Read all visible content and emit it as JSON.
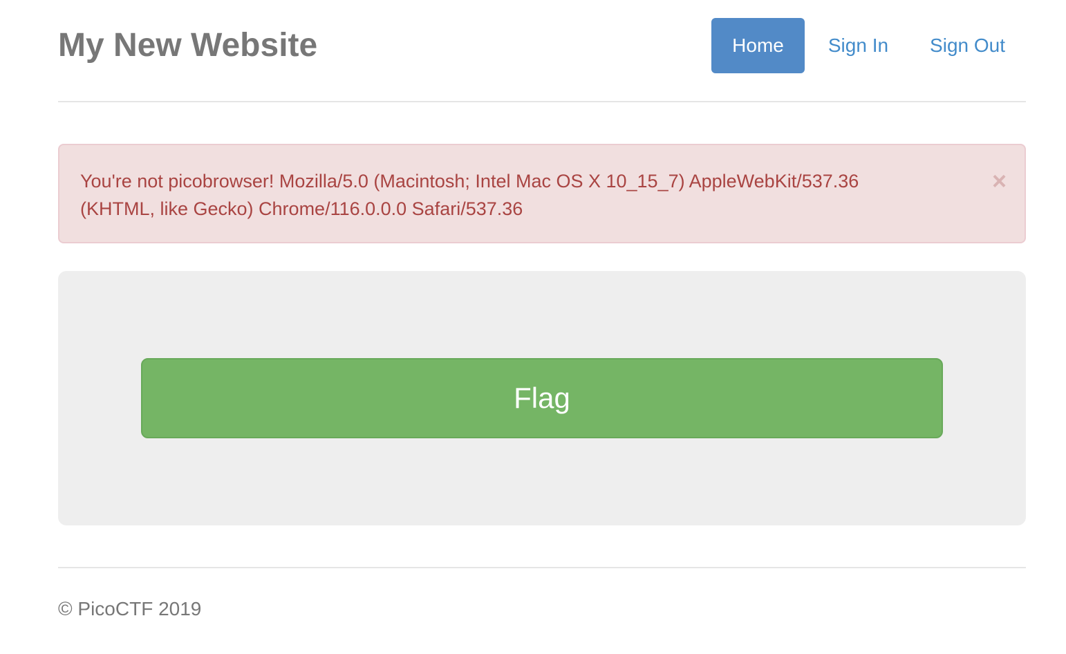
{
  "header": {
    "title": "My New Website",
    "nav": [
      {
        "label": "Home",
        "active": true
      },
      {
        "label": "Sign In",
        "active": false
      },
      {
        "label": "Sign Out",
        "active": false
      }
    ]
  },
  "alert": {
    "message": "You're not picobrowser! Mozilla/5.0 (Macintosh; Intel Mac OS X 10_15_7) AppleWebKit/537.36 (KHTML, like Gecko) Chrome/116.0.0.0 Safari/537.36",
    "close_symbol": "×"
  },
  "main": {
    "flag_button_label": "Flag"
  },
  "footer": {
    "text": "© PicoCTF 2019"
  },
  "colors": {
    "nav_active_bg": "#528ac7",
    "link": "#428bca",
    "alert_bg": "#f1dfdf",
    "alert_text": "#a94442",
    "flag_button_bg": "#75b565",
    "jumbotron_bg": "#eeeeee"
  }
}
